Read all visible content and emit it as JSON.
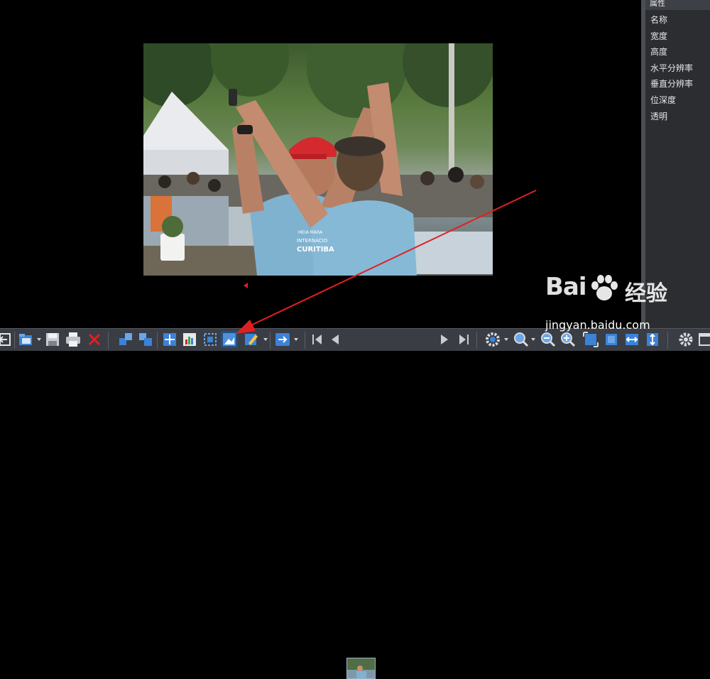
{
  "viewer": {
    "image_alt": "marathon runners celebrating"
  },
  "panel": {
    "header": "属性",
    "properties": [
      "名称",
      "宽度",
      "高度",
      "水平分辨率",
      "垂直分辨率",
      "位深度",
      "透明"
    ]
  },
  "watermark": {
    "brand_left": "Bai",
    "brand_right": "经验",
    "url": "jingyan.baidu.com"
  },
  "photo_text": {
    "shirt_line1": "MEIA MARA",
    "shirt_line2": "INTERNACIO",
    "shirt_line3": "CURITIBA"
  },
  "toolbar": {
    "buttons": [
      "exit-icon",
      "open-folder-icon",
      "save-icon",
      "print-icon",
      "delete-icon",
      "copy-icon",
      "paste-icon",
      "crop-icon",
      "color-icon",
      "select-icon",
      "adjust-icon",
      "edit-icon",
      "send-icon",
      "first-icon",
      "prev-icon",
      "next-icon",
      "last-icon",
      "settings-icon",
      "zoom-icon",
      "zoom-out-icon",
      "zoom-in-icon",
      "fit-icon",
      "actual-size-icon",
      "fit-width-icon",
      "fit-height-icon",
      "gear-icon",
      "fullscreen-icon"
    ]
  },
  "colors": {
    "toolbar_bg": "#3a3d43",
    "panel_bg": "#2b2d31",
    "annotation_arrow": "#e02020",
    "icon_blue": "#3b82d8"
  }
}
